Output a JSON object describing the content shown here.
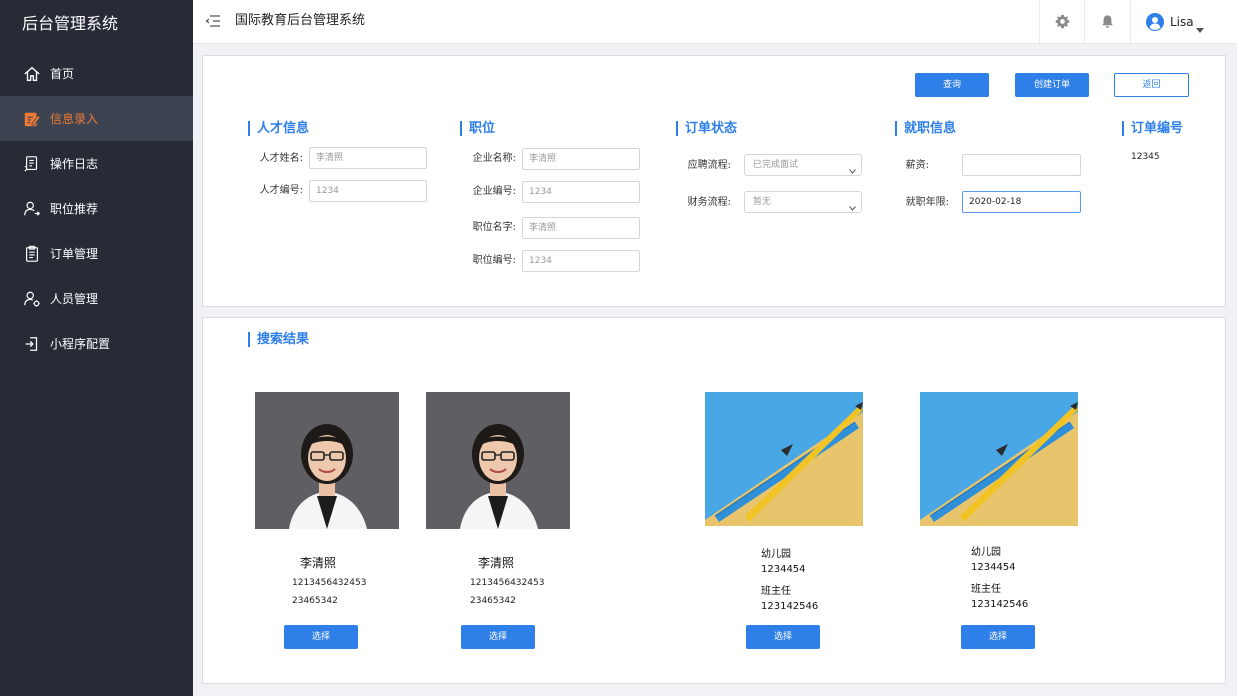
{
  "sidebar": {
    "title": "后台管理系统",
    "items": [
      {
        "label": "首页",
        "icon": "home-icon"
      },
      {
        "label": "信息录入",
        "icon": "edit-icon",
        "active": true
      },
      {
        "label": "操作日志",
        "icon": "log-icon"
      },
      {
        "label": "职位推荐",
        "icon": "user-share-icon"
      },
      {
        "label": "订单管理",
        "icon": "clipboard-icon"
      },
      {
        "label": "人员管理",
        "icon": "user-settings-icon"
      },
      {
        "label": "小程序配置",
        "icon": "exit-icon"
      }
    ]
  },
  "header": {
    "title": "国际教育后台管理系统",
    "user_name": "Lisa"
  },
  "form": {
    "buttons": {
      "query": "查询",
      "create_order": "创建订单",
      "back": "返回"
    },
    "talent": {
      "title": "人才信息",
      "name_label": "人才姓名:",
      "name_placeholder": "李清照",
      "id_label": "人才编号:",
      "id_placeholder": "1234"
    },
    "position": {
      "title": "职位",
      "company_name_label": "企业名称:",
      "company_name_placeholder": "李清照",
      "company_id_label": "企业编号:",
      "company_id_placeholder": "1234",
      "position_name_label": "职位名字:",
      "position_name_placeholder": "李清照",
      "position_id_label": "职位编号:",
      "position_id_placeholder": "1234"
    },
    "order_status": {
      "title": "订单状态",
      "apply_label": "应聘流程:",
      "apply_value": "已完成面试",
      "finance_label": "财务流程:",
      "finance_value": "暂无"
    },
    "employment": {
      "title": "就职信息",
      "salary_label": "薪资:",
      "salary_value": "",
      "period_label": "就职年限:",
      "period_value": "2020-02-18"
    },
    "order_id": {
      "title": "订单编号",
      "value": "12345"
    }
  },
  "results": {
    "title": "搜索结果",
    "select_label": "选择",
    "talents": [
      {
        "name": "李清照",
        "line1": "1213456432453",
        "line2": "23465342"
      },
      {
        "name": "李清照",
        "line1": "1213456432453",
        "line2": "23465342"
      }
    ],
    "positions": [
      {
        "line1": "幼儿园",
        "line2": "1234454",
        "line3": "班主任",
        "line4": "123142546"
      },
      {
        "line1": "幼儿园",
        "line2": "1234454",
        "line3": "班主任",
        "line4": "123142546"
      }
    ]
  },
  "colors": {
    "sidebar_bg": "#262b36",
    "sidebar_active_bg": "#3d4350",
    "sidebar_active_text": "#ee7b35",
    "accent": "#2f7fe9"
  }
}
